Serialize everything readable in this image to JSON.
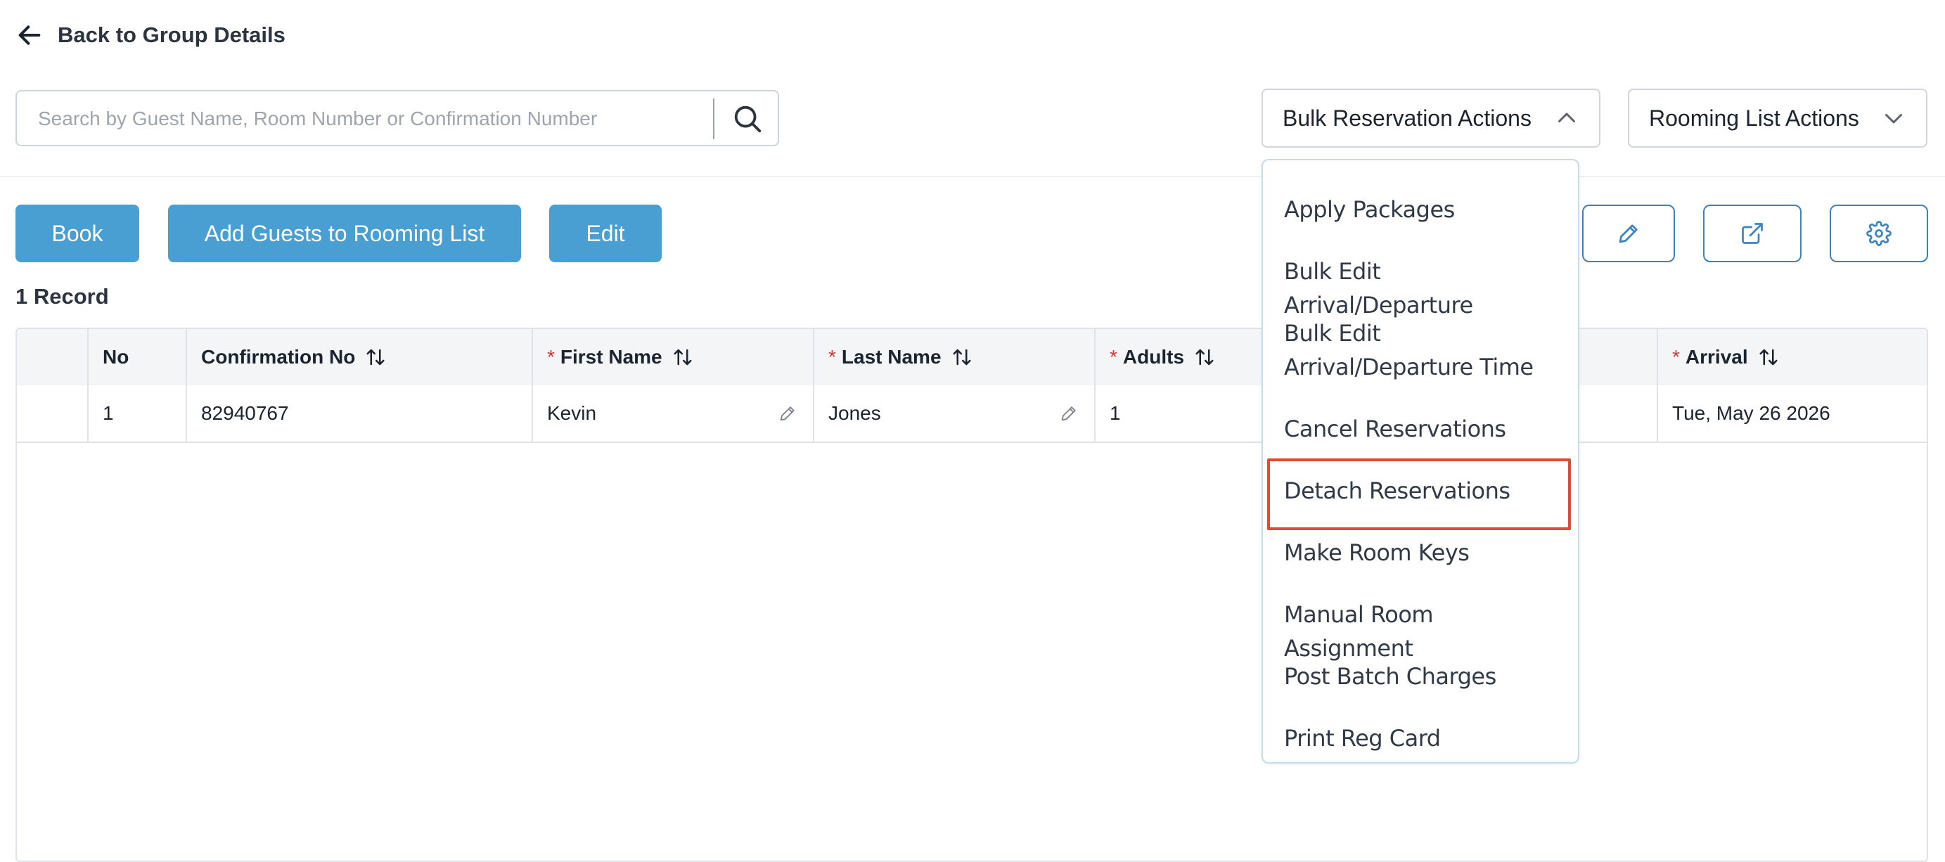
{
  "nav": {
    "back_label": "Back to Group Details",
    "back_icon": "arrow-left-icon"
  },
  "search": {
    "placeholder": "Search by Guest Name, Room Number or Confirmation Number",
    "value": ""
  },
  "dropdowns": {
    "bulk_label": "Bulk Reservation Actions",
    "bulk_state": "open",
    "rooming_label": "Rooming List Actions"
  },
  "actions": {
    "book": "Book",
    "add_guests": "Add Guests to Rooming List",
    "edit": "Edit"
  },
  "toolbar_icons": [
    "pencil-icon",
    "external-link-icon",
    "gear-icon"
  ],
  "records_label": "1 Record",
  "table": {
    "headers": {
      "no": "No",
      "confirmation": "Confirmation No",
      "first_name": "First Name",
      "last_name": "Last Name",
      "adults": "Adults",
      "arrival": "Arrival",
      "required_mark": "*"
    },
    "rows": [
      {
        "no": "1",
        "confirmation": "82940767",
        "first_name": "Kevin",
        "last_name": "Jones",
        "adults": "1",
        "arrival": "Tue, May 26 2026"
      }
    ]
  },
  "bulk_menu": {
    "items": [
      "Apply Packages",
      "Bulk Edit Arrival/Departure",
      "Bulk Edit Arrival/Departure Time",
      "Cancel Reservations",
      "Detach Reservations",
      "Make Room Keys",
      "Manual Room Assignment",
      "Post Batch Charges",
      "Print Reg Card"
    ],
    "highlighted": "Detach Reservations"
  },
  "colors": {
    "primary": "#4a9fd2",
    "outline": "#3a83c1",
    "highlight": "#e04a36",
    "required": "#d93a3a"
  }
}
